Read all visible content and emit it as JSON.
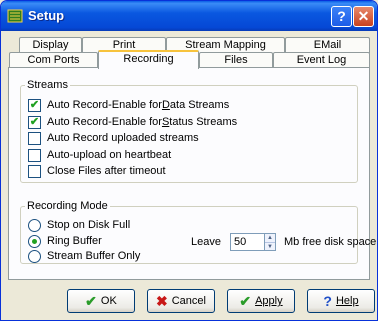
{
  "window": {
    "title": "Setup"
  },
  "title_buttons": {
    "help": "?",
    "close": "✕"
  },
  "tabs_row_top": [
    "Display",
    "Print",
    "Stream Mapping",
    "EMail"
  ],
  "tabs_row_bottom": [
    "Com Ports",
    "Recording",
    "Files",
    "Event Log"
  ],
  "active_tab": "Recording",
  "streams": {
    "legend": "Streams",
    "items": [
      {
        "pre": "Auto Record-Enable for ",
        "hot": "D",
        "post": "ata Streams",
        "checked": true
      },
      {
        "pre": "Auto Record-Enable for ",
        "hot": "S",
        "post": "tatus Streams",
        "checked": true
      },
      {
        "pre": "Auto Record uploaded streams",
        "hot": "",
        "post": "",
        "checked": false
      },
      {
        "pre": "Auto-upload on heartbeat",
        "hot": "",
        "post": "",
        "checked": false
      },
      {
        "pre": "Close Files after timeout",
        "hot": "",
        "post": "",
        "checked": false
      }
    ]
  },
  "recording_mode": {
    "legend": "Recording Mode",
    "options": [
      {
        "label": "Stop on Disk Full",
        "selected": false
      },
      {
        "label": "Ring Buffer",
        "selected": true
      },
      {
        "label": "Stream Buffer Only",
        "selected": false
      }
    ],
    "leave_label": "Leave",
    "leave_value": "50",
    "leave_suffix": "Mb free disk space"
  },
  "buttons": {
    "ok": "OK",
    "cancel": "Cancel",
    "apply": "Apply",
    "help": "Help"
  },
  "colors": {
    "title_bar": "#0548d6",
    "check_mark": "#21a121",
    "active_tab_accent": "#f7c33d"
  }
}
